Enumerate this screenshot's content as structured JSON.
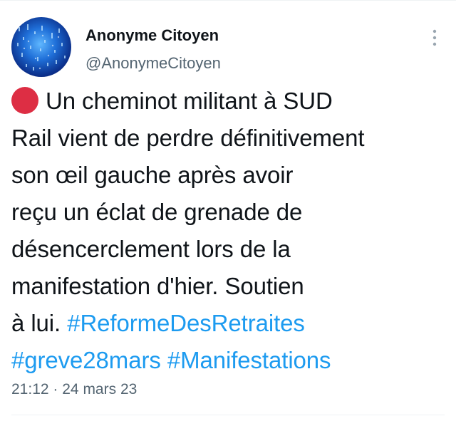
{
  "tweet": {
    "author": {
      "name": "Anonyme Citoyen",
      "handle": "@AnonymeCitoyen"
    },
    "emoji": "red-circle-emoji",
    "text_lines": [
      "Un cheminot militant à SUD",
      "Rail vient de perdre définitivement",
      "son œil gauche après avoir",
      "reçu un éclat de grenade de",
      "désencerclement lors de la",
      "manifestation d'hier. Soutien",
      "à lui."
    ],
    "hashtags": [
      "#ReformeDesRetraites",
      "#greve28mars",
      "#Manifestations"
    ],
    "time": "21:12",
    "separator": "·",
    "date": "24 mars 23"
  },
  "colors": {
    "text": "#0f1419",
    "secondary": "#536471",
    "link": "#1d9bf0",
    "red_circle": "#dd2e44",
    "divider": "#eff3f4"
  },
  "icons": {
    "more": "vertical-ellipsis-icon"
  }
}
